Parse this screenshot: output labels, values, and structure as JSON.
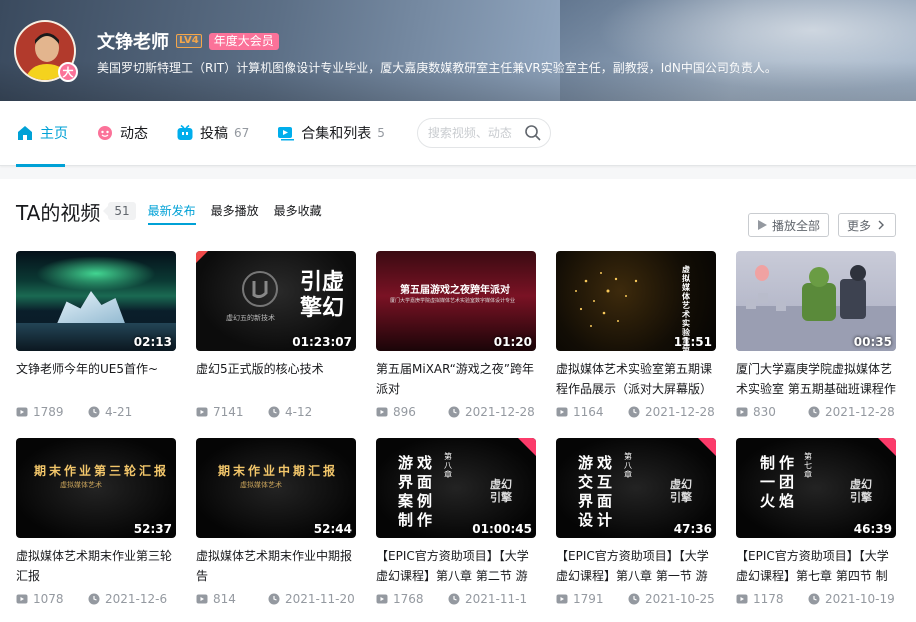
{
  "profile": {
    "name": "文铮老师",
    "level": "LV4",
    "vip": "年度大会员",
    "sign": "美国罗切斯特理工（RIT）计算机图像设计专业毕业，厦大嘉庚数媒教研室主任兼VR实验室主任，副教授，IdN中国公司负责人。",
    "avatar_badge": "大"
  },
  "nav": {
    "home": "主页",
    "dynamic": "动态",
    "upload": "投稿",
    "upload_count": "67",
    "collections": "合集和列表",
    "collections_count": "5",
    "search_placeholder": "搜索视频、动态"
  },
  "section": {
    "title": "TA的视频",
    "count": "51",
    "sort_tabs": [
      "最新发布",
      "最多播放",
      "最多收藏"
    ],
    "play_all": "播放全部",
    "more": "更多"
  },
  "videos": [
    {
      "title": "文铮老师今年的UE5首作~",
      "duration": "02:13",
      "plays": "1789",
      "date": "4-21"
    },
    {
      "title": "虚幻5正式版的核心技术",
      "duration": "01:23:07",
      "plays": "7141",
      "date": "4-12"
    },
    {
      "title": "第五届MiXAR“游戏之夜”跨年派对",
      "duration": "01:20",
      "plays": "896",
      "date": "2021-12-28"
    },
    {
      "title": "虚拟媒体艺术实验室第五期课程作品展示（派对大屏幕版）",
      "duration": "11:51",
      "plays": "1164",
      "date": "2021-12-28"
    },
    {
      "title": "厦门大学嘉庚学院虚拟媒体艺术实验室 第五期基础班课程作品展示",
      "duration": "00:35",
      "plays": "830",
      "date": "2021-12-28"
    },
    {
      "title": "虚拟媒体艺术期末作业第三轮汇报",
      "duration": "52:37",
      "plays": "1078",
      "date": "2021-12-6"
    },
    {
      "title": "虚拟媒体艺术期末作业中期报告",
      "duration": "52:44",
      "plays": "814",
      "date": "2021-11-20"
    },
    {
      "title": "【EPIC官方资助项目】【大学虚幻课程】第八章 第二节 游戏界面制作",
      "duration": "01:00:45",
      "plays": "1768",
      "date": "2021-11-1"
    },
    {
      "title": "【EPIC官方资助项目】【大学虚幻课程】第八章 第一节 游戏交互界面设计",
      "duration": "47:36",
      "plays": "1791",
      "date": "2021-10-25"
    },
    {
      "title": "【EPIC官方资助项目】【大学虚幻课程】第七章 第四节 制作一团火焰",
      "duration": "46:39",
      "plays": "1178",
      "date": "2021-10-19"
    }
  ],
  "thumb_text": {
    "v2_big": "引虚擎幻",
    "v2_small": "虚幻五的新技术",
    "v3_big": "第五届游戏之夜跨年派对",
    "v3_small": "厦门大学嘉庚学院虚拟媒体艺术实验室数字媒体设计专业",
    "v4_side": "虚拟媒体艺术实验室第五期",
    "v6_big": "期末作业第三轮汇报",
    "v6_sub": "虚拟媒体艺术",
    "v7_big": "期末作业中期汇报",
    "v7_sub": "虚拟媒体艺术",
    "v8_big": "游戏界面案例制作",
    "v8_ch": "第八章",
    "v9_big": "游戏交互界面设计",
    "v9_ch": "第八章",
    "v10_big": "制作一团火焰",
    "v10_ch": "第七章",
    "epic_logo": "虚幻引擎",
    "teacher": "文铮老师"
  }
}
